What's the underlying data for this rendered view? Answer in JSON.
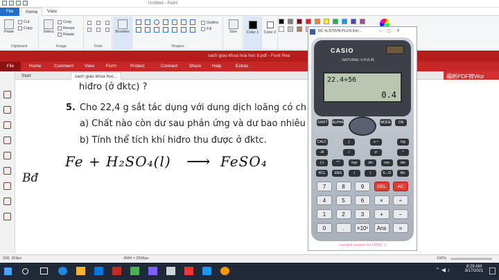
{
  "paint": {
    "title": "Untitled - Paint",
    "tabs": {
      "file": "File",
      "home": "Home",
      "view": "View"
    },
    "groups": {
      "clipboard": {
        "label": "Clipboard",
        "paste": "Paste",
        "cut": "Cut",
        "copy": "Copy"
      },
      "image": {
        "label": "Image",
        "select": "Select",
        "crop": "Crop",
        "resize": "Resize",
        "rotate": "Rotate"
      },
      "tools": {
        "label": "Tools"
      },
      "brushes": "Brushes",
      "shapes": {
        "label": "Shapes",
        "outline": "Outline",
        "fill": "Fill"
      },
      "size": "Size",
      "color1": "Color 1",
      "color2": "Color 2"
    },
    "swatches": [
      "#000000",
      "#7f7f7f",
      "#880015",
      "#ed1c24",
      "#ff7f27",
      "#fff200",
      "#22b14c",
      "#00a2e8",
      "#3f48cc",
      "#a349a4",
      "#ffffff",
      "#c3c3c3",
      "#b97a57",
      "#ffaec9",
      "#ffc90e",
      "#efe4b0",
      "#b5e61d",
      "#99d9ea",
      "#7092be",
      "#c8bfe7"
    ],
    "status": {
      "cursor": "328, 324px",
      "canvas": "4584 × 2596px",
      "zoom": "100%"
    }
  },
  "foxit": {
    "title": "sach giao khoa hoa hoc 8.pdf - Foxit Rea",
    "menu": [
      "File",
      "Home",
      "Comment",
      "View",
      "Form",
      "Protect",
      "Connect",
      "Share",
      "Help",
      "Extras"
    ],
    "tabs": {
      "start": "Start",
      "doc": "sach giao khoa hoc..."
    },
    "ad": "福昕PDF转Wor",
    "lines": {
      "l0": "hiđro (ở đktc) ?",
      "num": "5.",
      "l1": "Cho 22,4 g sắt tác dụng với dung dịch loãng có ch",
      "a": "a) Chất nào còn dư sau phản ứng và dư bao nhiêu",
      "b": "b) Tính thể tích khí hiđro thu được ở đktc."
    },
    "handwriting": {
      "eq_left": "Fe + H₂SO₄(l)",
      "arrow": "⟶",
      "eq_right": "FeSO₄",
      "side": "Bđ"
    }
  },
  "calc": {
    "window_title": "RC fx-570VN PLUS Em...",
    "brand": "CASIO",
    "model": "NATURAL-V.P.A.M.",
    "expression": "22.4÷56",
    "result": "0.4",
    "watermark": "cracked version for HTKC :)",
    "top_keys": [
      "SHIFT",
      "ALPHA",
      "MODE",
      "ON"
    ],
    "fn_rows": [
      [
        "CALC",
        "∫",
        "x⁻¹",
        "log"
      ],
      [
        "÷R",
        "√",
        "x²",
        "^"
      ],
      [
        "(-)",
        "°'\"",
        "hyp",
        "sin",
        "cos",
        "tan"
      ],
      [
        "RCL",
        "ENG",
        "(",
        ")",
        "S⇔D",
        "M+"
      ]
    ],
    "num_rows": [
      [
        "7",
        "8",
        "9",
        "DEL",
        "AC"
      ],
      [
        "4",
        "5",
        "6",
        "×",
        "÷"
      ],
      [
        "1",
        "2",
        "3",
        "+",
        "−"
      ],
      [
        "0",
        ".",
        "×10ˣ",
        "Ans",
        "="
      ]
    ]
  },
  "taskbar": {
    "time": "8:29 AM",
    "date": "3/17/2021"
  }
}
